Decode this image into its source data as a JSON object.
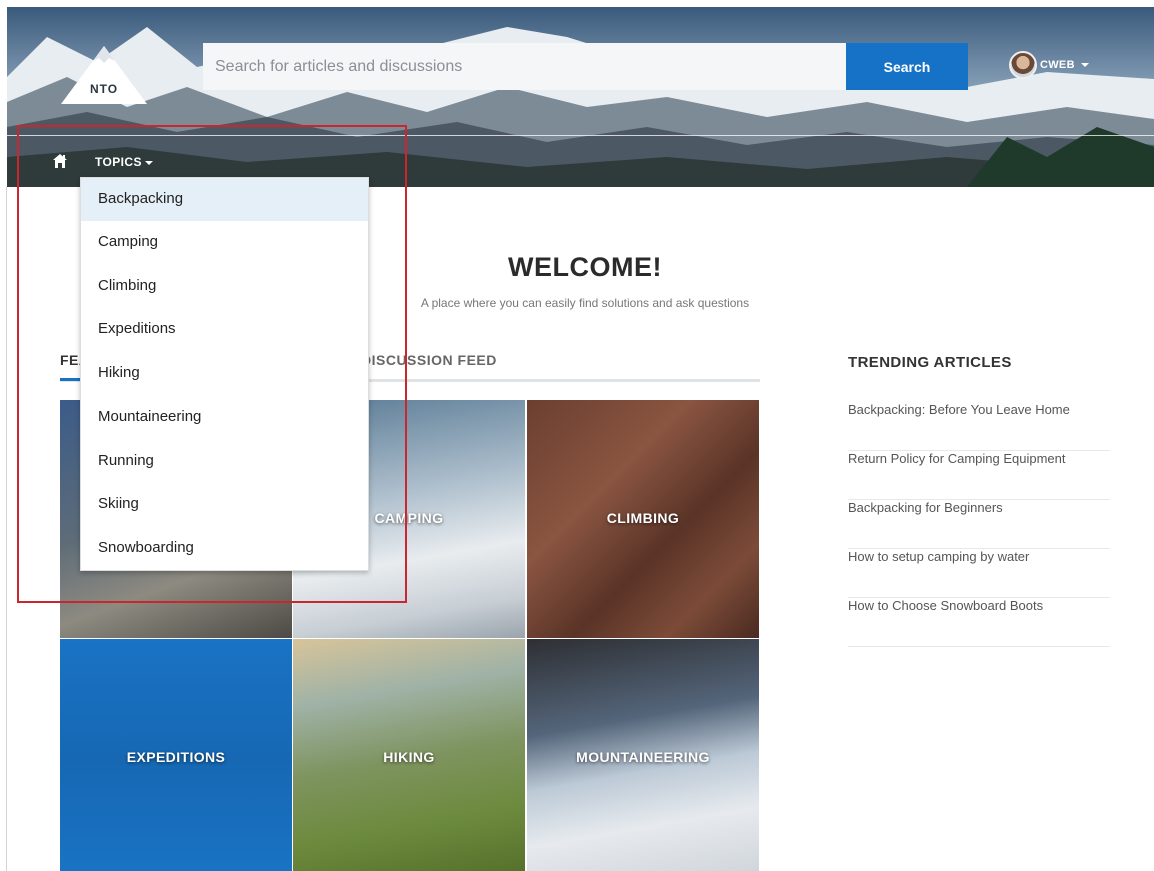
{
  "header": {
    "logo_text": "NTO",
    "search_placeholder": "Search for articles and discussions",
    "search_button": "Search",
    "user_name": "CWEB"
  },
  "nav": {
    "topics_label": "TOPICS"
  },
  "welcome": {
    "title": "WELCOME!",
    "subtitle": "A place where you can easily find solutions and ask questions"
  },
  "tabs": {
    "featured": "FEATURED",
    "feed": "DISCUSSION FEED"
  },
  "tiles": [
    {
      "label": ""
    },
    {
      "label": "CAMPING"
    },
    {
      "label": "CLIMBING"
    },
    {
      "label": "EXPEDITIONS"
    },
    {
      "label": "HIKING"
    },
    {
      "label": "MOUNTAINEERING"
    }
  ],
  "trending": {
    "title": "TRENDING ARTICLES",
    "items": [
      "Backpacking: Before You Leave Home",
      "Return Policy for Camping Equipment",
      "Backpacking for Beginners",
      "How to setup camping by water",
      "How to Choose Snowboard Boots"
    ]
  },
  "dropdown": {
    "items": [
      "Backpacking",
      "Camping",
      "Climbing",
      "Expeditions",
      "Hiking",
      "Mountaineering",
      "Running",
      "Skiing",
      "Snowboarding"
    ],
    "active_index": 0
  },
  "colors": {
    "accent": "#1672c6",
    "highlight": "#c9262d",
    "dropdown_active": "#e4eff7"
  }
}
